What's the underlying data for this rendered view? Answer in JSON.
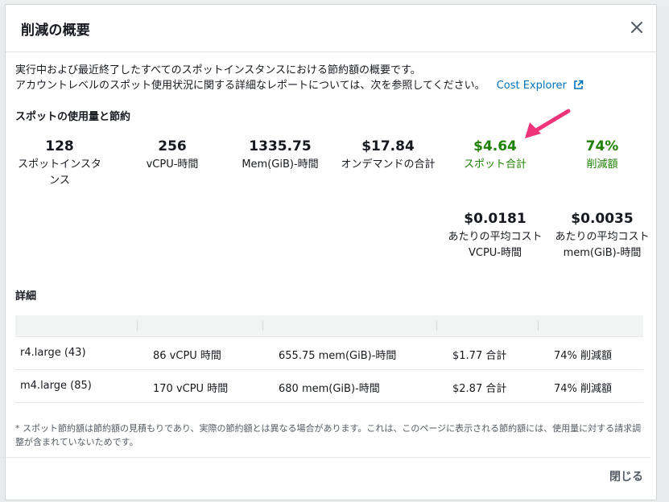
{
  "modal": {
    "title": "削減の概要",
    "description_line1": "実行中および最近終了したすべてのスポットインスタンスにおける節約額の概要です。",
    "description_line2": "アカウントレベルのスポット使用状況に関する詳細なレポートについては、次を参照してください。",
    "link_text": "Cost Explorer",
    "usage_section_title": "スポットの使用量と節約",
    "stats": [
      {
        "value": "128",
        "label": "スポットインスタンス"
      },
      {
        "value": "256",
        "label": "vCPU-時間"
      },
      {
        "value": "1335.75",
        "label": "Mem(GiB)-時間"
      },
      {
        "value": "$17.84",
        "label": "オンデマンドの合計"
      },
      {
        "value": "$4.64",
        "label": "スポット合計"
      },
      {
        "value": "74%",
        "label": "削減額"
      }
    ],
    "avg_stats": [
      {
        "value": "$0.0181",
        "label": "あたりの平均コスト VCPU-時間"
      },
      {
        "value": "$0.0035",
        "label": "あたりの平均コスト mem(GiB)-時間"
      }
    ],
    "details_section_title": "詳細",
    "rows": [
      {
        "instance": "r4.large (43)",
        "vcpu": "86 vCPU 時間",
        "mem": "655.75 mem(GiB)-時間",
        "total": "$1.77 合計",
        "savings": "74% 削減額"
      },
      {
        "instance": "m4.large (85)",
        "vcpu": "170 vCPU 時間",
        "mem": "680 mem(GiB)-時間",
        "total": "$2.87 合計",
        "savings": "74% 削減額"
      }
    ],
    "footnote": "* スポット節約額は節約額の見積もりであり、実際の節約額とは異なる場合があります。これは、このページに表示される節約額には、使用量に対する請求調整が含まれていないためです。",
    "close_button": "閉じる"
  },
  "colors": {
    "accent_link": "#0073bb",
    "savings_green": "#1d8102",
    "annotation_arrow": "#f0347a"
  },
  "icons": [
    "close-icon",
    "external-link-icon",
    "annotation-arrow-icon"
  ]
}
